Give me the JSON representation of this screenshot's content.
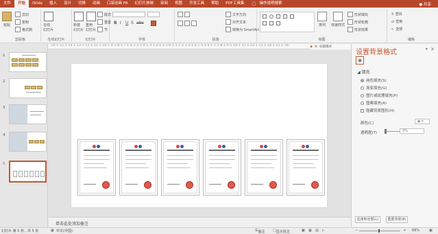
{
  "menu": {
    "tabs": [
      "文件",
      "开始",
      "iSlide",
      "插入",
      "设计",
      "切换",
      "动画",
      "口袋动画 PA",
      "幻灯片放映",
      "审阅",
      "视图",
      "开发工具",
      "帮助",
      "PDF工具集"
    ],
    "active_tab": "开始",
    "tell_me": "操作说明搜索",
    "share": "共享"
  },
  "ribbon": {
    "clipboard": {
      "paste": "粘贴",
      "cut": "剪切",
      "copy": "复制",
      "format_painter": "格式刷",
      "label": "剪贴板"
    },
    "online_slides": {
      "button": "在线\n幻灯片",
      "label": "在线幻灯片"
    },
    "slides": {
      "new_slide": "新建\n幻灯片",
      "reuse": "重用\n幻灯片",
      "layout": "版式",
      "reset": "重置",
      "section": "节",
      "label": "幻灯片"
    },
    "font": {
      "label": "字体"
    },
    "paragraph": {
      "text_direction": "文字方向",
      "align_text": "对齐文本",
      "convert_smartart": "转换为 SmartArt",
      "label": "段落"
    },
    "drawing": {
      "arrange": "排列",
      "quick_styles": "快速样式",
      "shape_fill": "形状填充",
      "shape_outline": "形状轮廓",
      "shape_effects": "形状效果",
      "label": "绘图"
    },
    "editing": {
      "find": "查找",
      "replace": "替换",
      "select": "选择",
      "label": "编辑"
    }
  },
  "ruler_text": "·16·1·15·1·14·1·13·1·12·1·11·1·10·1·9·1·8·1·7·1·6·1·5·1·4·1·3·1·2·1·1·1·0·1·1·1·2·1·3·1·4·1·5·1·6·1·7·1·8·1·9·1·10·1·11·1·12·1·13·1·14·1·15·1·16·",
  "ruler_tools": {
    "label": "标题模式"
  },
  "thumbnails": [
    {
      "number": "1"
    },
    {
      "number": "2"
    },
    {
      "number": "3"
    },
    {
      "number": "4"
    },
    {
      "number": "5"
    }
  ],
  "selected_slide": "5",
  "notes_placeholder": "单击此处添加备注",
  "format_pane": {
    "title": "设置背景格式",
    "section": "填充",
    "options": [
      {
        "label": "纯色填充(S)",
        "selected": true
      },
      {
        "label": "渐变填充(G)",
        "selected": false
      },
      {
        "label": "图片或纹理填充(P)",
        "selected": false
      },
      {
        "label": "图案填充(A)",
        "selected": false
      }
    ],
    "hide_bg": "隐藏背景图形(H)",
    "color_label": "颜色(C)",
    "transparency_label": "透明度(T)",
    "transparency_value": "0%",
    "apply_all": "应用到全部(L)",
    "reset_bg": "重置背景(B)"
  },
  "status": {
    "slide_info": "幻灯片 第 5 张，共 5 张",
    "language": "中文(中国)",
    "notes": "备注",
    "comments": "显示批注",
    "zoom": "68%"
  }
}
